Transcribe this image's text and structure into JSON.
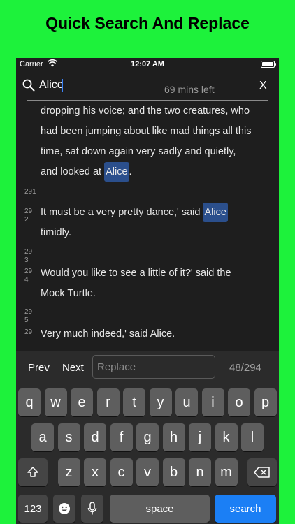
{
  "headline": "Quick Search And Replace",
  "status": {
    "carrier": "Carrier",
    "time": "12:07 AM"
  },
  "search": {
    "value": "Alice",
    "time_left": "69 mins left",
    "close_label": "X"
  },
  "lines": [
    {
      "text": "dropping his voice; and the two creatures, who"
    },
    {
      "text": "had been jumping about like mad things all this"
    },
    {
      "text": "time, sat down again very sadly and quietly,"
    },
    {
      "pre": "and looked at ",
      "match": "Alice",
      "post": "."
    },
    {
      "pre": "It must be a very pretty dance,' said ",
      "match": "Alice",
      "post": ""
    },
    {
      "text": "timidly."
    },
    {
      "text": "Would you like to see a little of it?' said the"
    },
    {
      "text": "Mock Turtle."
    },
    {
      "text": "Very much indeed,' said Alice."
    }
  ],
  "line_numbers": [
    "291",
    "29",
    "2",
    "29",
    "3",
    "29",
    "4",
    "29",
    "5",
    "29"
  ],
  "replace_bar": {
    "prev": "Prev",
    "next": "Next",
    "placeholder": "Replace",
    "counter": "48/294"
  },
  "keyboard": {
    "row1": [
      "q",
      "w",
      "e",
      "r",
      "t",
      "y",
      "u",
      "i",
      "o",
      "p"
    ],
    "row2": [
      "a",
      "s",
      "d",
      "f",
      "g",
      "h",
      "j",
      "k",
      "l"
    ],
    "row3": [
      "z",
      "x",
      "c",
      "v",
      "b",
      "n",
      "m"
    ],
    "num_label": "123",
    "space_label": "space",
    "search_label": "search"
  },
  "colors": {
    "background": "#1df23b",
    "highlight": "#2b4f8c",
    "search_key": "#1b7ff5"
  }
}
